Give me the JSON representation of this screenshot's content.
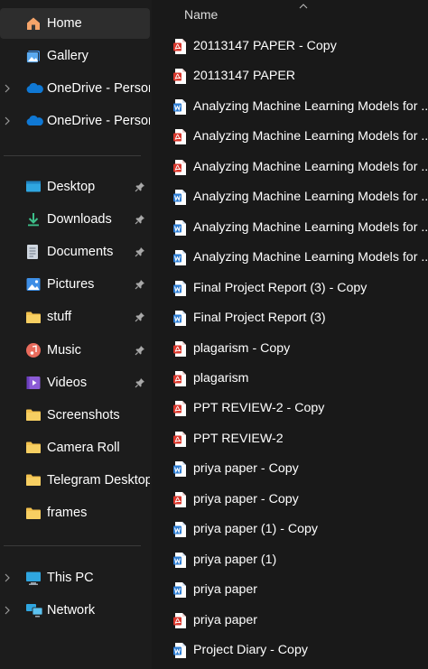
{
  "sidebar": {
    "quick": [
      {
        "label": "Home",
        "icon": "home-icon",
        "selected": true
      },
      {
        "label": "Gallery",
        "icon": "gallery-icon"
      },
      {
        "label": "OneDrive - Persona",
        "icon": "onedrive-cloud-icon",
        "expandable": true
      },
      {
        "label": "OneDrive - Persona",
        "icon": "onedrive-cloud-icon",
        "expandable": true
      }
    ],
    "pinned": [
      {
        "label": "Desktop",
        "icon": "desktop-icon",
        "pinned": true
      },
      {
        "label": "Downloads",
        "icon": "downloads-icon",
        "pinned": true
      },
      {
        "label": "Documents",
        "icon": "documents-icon",
        "pinned": true
      },
      {
        "label": "Pictures",
        "icon": "pictures-icon",
        "pinned": true
      },
      {
        "label": "stuff",
        "icon": "folder-icon",
        "pinned": true
      },
      {
        "label": "Music",
        "icon": "music-icon",
        "pinned": true
      },
      {
        "label": "Videos",
        "icon": "videos-icon",
        "pinned": true
      },
      {
        "label": "Screenshots",
        "icon": "folder-icon"
      },
      {
        "label": "Camera Roll",
        "icon": "folder-icon"
      },
      {
        "label": "Telegram Desktop",
        "icon": "folder-icon"
      },
      {
        "label": "frames",
        "icon": "folder-icon"
      }
    ],
    "devices": [
      {
        "label": "This PC",
        "icon": "this-pc-icon",
        "expandable": true
      },
      {
        "label": "Network",
        "icon": "network-icon",
        "expandable": true
      }
    ]
  },
  "list": {
    "column_header": "Name",
    "files": [
      {
        "name": "20113147 PAPER - Copy",
        "type": "pdf"
      },
      {
        "name": "20113147 PAPER",
        "type": "pdf"
      },
      {
        "name": "Analyzing Machine Learning Models for ...",
        "type": "word"
      },
      {
        "name": "Analyzing Machine Learning Models for ...",
        "type": "pdf"
      },
      {
        "name": "Analyzing Machine Learning Models for ...",
        "type": "pdf"
      },
      {
        "name": "Analyzing Machine Learning Models for ...",
        "type": "word"
      },
      {
        "name": "Analyzing Machine Learning Models for ...",
        "type": "word"
      },
      {
        "name": "Analyzing Machine Learning Models for ...",
        "type": "word"
      },
      {
        "name": "Final Project Report (3) - Copy",
        "type": "word"
      },
      {
        "name": "Final Project Report (3)",
        "type": "word"
      },
      {
        "name": "plagarism - Copy",
        "type": "pdf"
      },
      {
        "name": "plagarism",
        "type": "pdf"
      },
      {
        "name": "PPT REVIEW-2 - Copy",
        "type": "pdf"
      },
      {
        "name": "PPT REVIEW-2",
        "type": "pdf"
      },
      {
        "name": "priya paper - Copy",
        "type": "word"
      },
      {
        "name": "priya paper - Copy",
        "type": "pdf"
      },
      {
        "name": "priya paper (1) - Copy",
        "type": "word"
      },
      {
        "name": "priya paper (1)",
        "type": "word"
      },
      {
        "name": "priya paper",
        "type": "word"
      },
      {
        "name": "priya paper",
        "type": "pdf"
      },
      {
        "name": "Project Diary - Copy",
        "type": "word"
      }
    ]
  },
  "colors": {
    "sidebar_bg": "#1c1c1c",
    "content_bg": "#191919",
    "selected_bg": "#2d2d2d",
    "folder": "#f2c14e",
    "word_blue": "#2b7cd3",
    "pdf_red": "#d9362b"
  }
}
